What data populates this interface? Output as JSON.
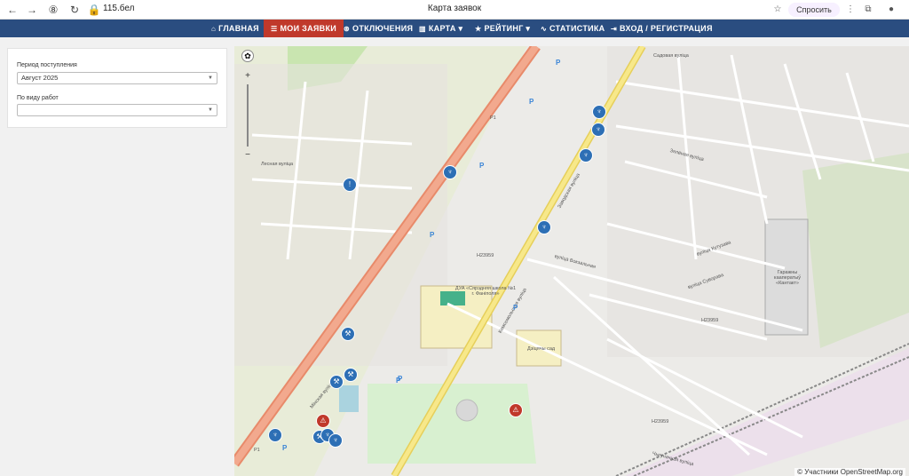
{
  "browser": {
    "url": "115.бел",
    "tab_title": "Карта заявок",
    "ask_label": "Спросить"
  },
  "nav": {
    "items": [
      {
        "label": "ГЛАВНАЯ",
        "icon": "home-icon"
      },
      {
        "label": "МОИ ЗАЯВКИ",
        "icon": "list-icon"
      },
      {
        "label": "ОТКЛЮЧЕНИЯ",
        "icon": "outage-icon"
      },
      {
        "label": "КАРТА ▾",
        "icon": "map-icon"
      },
      {
        "label": "РЕЙТИНГ ▾",
        "icon": "star-icon"
      },
      {
        "label": "СТАТИСТИКА",
        "icon": "chart-icon"
      },
      {
        "label": "ВХОД / РЕГИСТРАЦИЯ",
        "icon": "login-icon"
      }
    ]
  },
  "filters": {
    "period_label": "Период поступления",
    "period_value": "Август 2025",
    "work_type_label": "По виду работ",
    "work_type_value": ""
  },
  "map": {
    "attribution": "© Участники OpenStreetMap.org",
    "labels": {
      "school": "ДУА «Сярэдняя школа №1 г. Фаніполя»",
      "garages": "Гаражны кааператыў «Кантакт»",
      "road_h1": "H23959",
      "road_h2": "H23959",
      "road_h3": "H23959",
      "road_p1": "P1",
      "road_p1b": "P1",
      "street1": "Заводская вуліца",
      "street2": "Комсомольская вуліца",
      "street3": "Садовая вуліца",
      "street4": "Зялёная вуліца",
      "street5": "Чыгуначная вуліца",
      "street6": "Лесная вуліца",
      "street7": "Мінская вуліца",
      "street8": "вуліца Кутузава",
      "street9": "вуліца Суворава",
      "street10": "вуліца Вокзальная",
      "kindergarten": "Дзіцячы сад"
    }
  },
  "colors": {
    "nav_bg": "#2a4d80",
    "nav_active": "#c0392b",
    "marker_blue": "#2d6fb5",
    "marker_red": "#c0392b"
  }
}
